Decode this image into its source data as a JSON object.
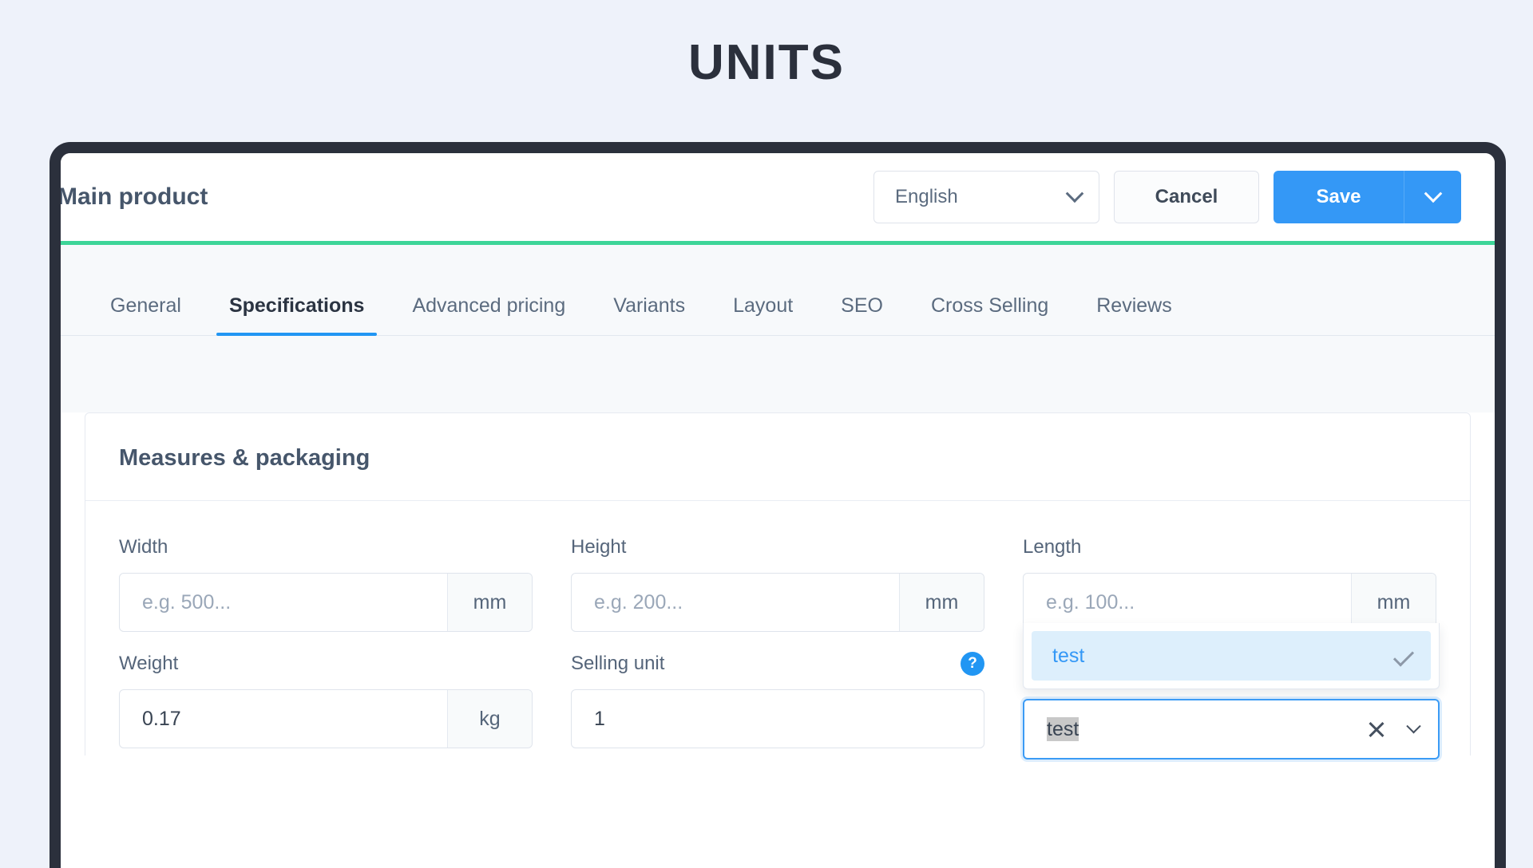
{
  "page": {
    "title": "UNITS"
  },
  "header": {
    "product_title": "Main product",
    "language_value": "English",
    "language_caret_icon": "chevron-down-icon",
    "cancel_label": "Cancel",
    "save_label": "Save",
    "save_caret_icon": "chevron-down-icon"
  },
  "tabs": [
    {
      "label": "General",
      "active": false
    },
    {
      "label": "Specifications",
      "active": true
    },
    {
      "label": "Advanced pricing",
      "active": false
    },
    {
      "label": "Variants",
      "active": false
    },
    {
      "label": "Layout",
      "active": false
    },
    {
      "label": "SEO",
      "active": false
    },
    {
      "label": "Cross Selling",
      "active": false
    },
    {
      "label": "Reviews",
      "active": false
    }
  ],
  "card": {
    "heading": "Measures & packaging",
    "fields": {
      "width": {
        "label": "Width",
        "value": "",
        "placeholder": "e.g. 500...",
        "unit": "mm"
      },
      "height": {
        "label": "Height",
        "value": "",
        "placeholder": "e.g. 200...",
        "unit": "mm"
      },
      "length": {
        "label": "Length",
        "value": "",
        "placeholder": "e.g. 100...",
        "unit": "mm"
      },
      "weight": {
        "label": "Weight",
        "value": "0.17",
        "placeholder": "",
        "unit": "kg"
      },
      "selling_unit": {
        "label": "Selling unit",
        "value": "1",
        "placeholder": "",
        "help_icon": "question-mark-icon"
      }
    },
    "unit_autocomplete": {
      "suggestions": [
        {
          "label": "test",
          "selected": true,
          "check_icon": "check-icon"
        }
      ],
      "input_value": "test",
      "clear_icon": "close-icon",
      "caret_icon": "chevron-down-icon"
    }
  },
  "colors": {
    "page_background": "#eef2fa",
    "frame": "#2b303c",
    "accent_blue": "#3498f6",
    "accent_green": "#3dd598",
    "tab_active_underline": "#2196f3",
    "suggestion_highlight": "#ddeffc"
  }
}
